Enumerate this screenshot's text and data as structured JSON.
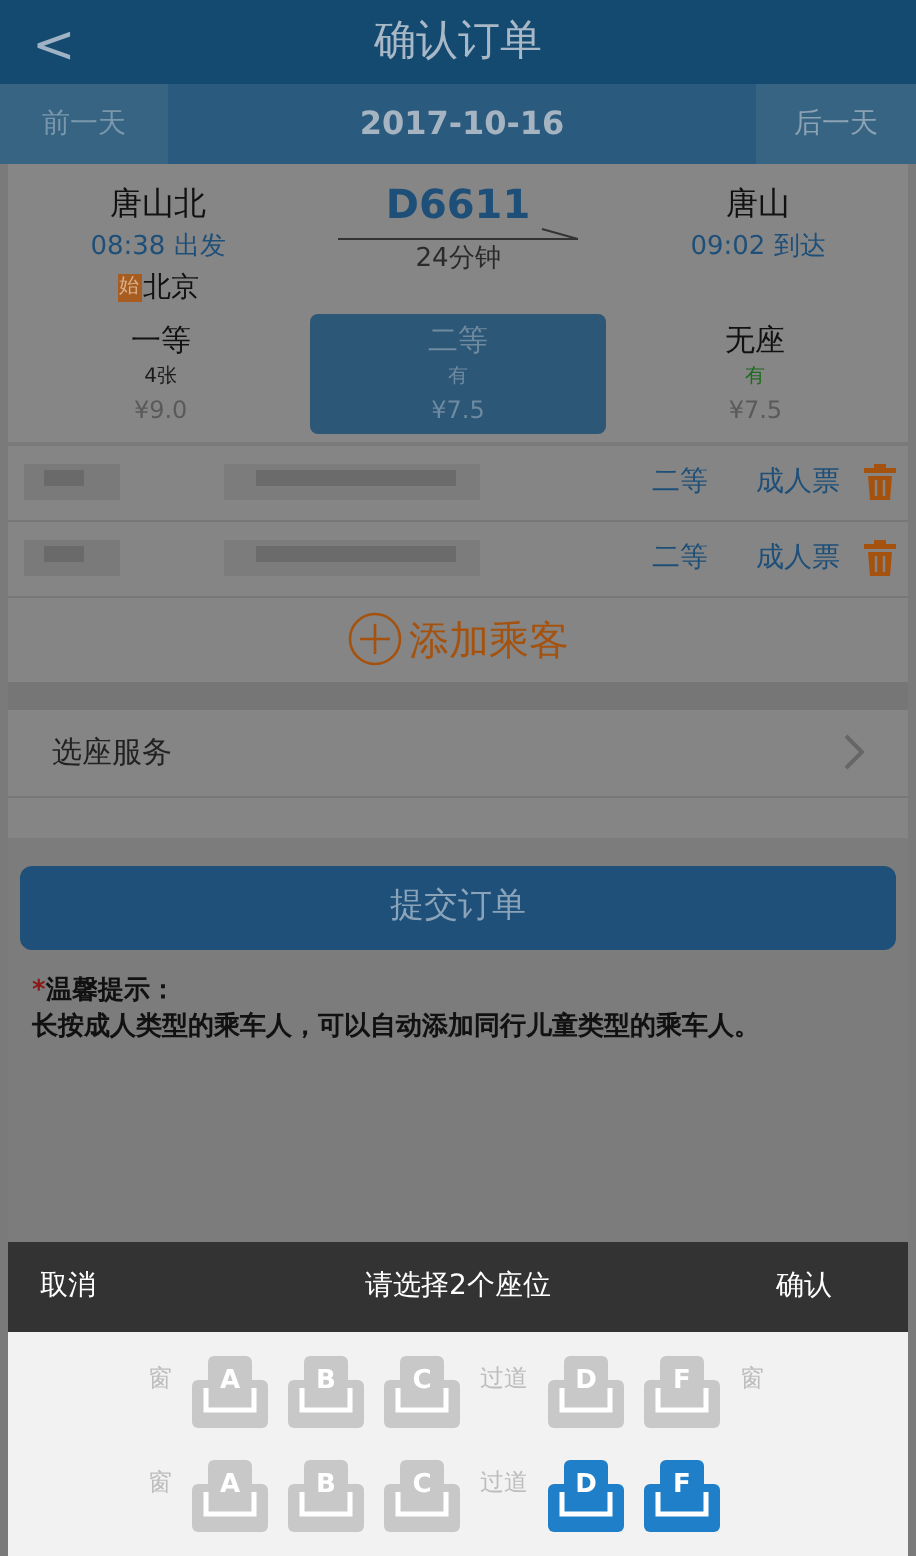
{
  "header": {
    "back": "<",
    "title": "确认订单"
  },
  "date_bar": {
    "prev": "前一天",
    "date": "2017-10-16",
    "next": "后一天"
  },
  "train": {
    "from": {
      "station": "唐山北",
      "time": "08:38 出发",
      "origin_badge": "始",
      "origin": "北京"
    },
    "number": "D6611",
    "duration": "24分钟",
    "to": {
      "station": "唐山",
      "time": "09:02 到达"
    }
  },
  "seat_classes": [
    {
      "name": "一等",
      "availability": "4张",
      "price": "¥9.0",
      "selected": false,
      "color": "#1a1a1a"
    },
    {
      "name": "二等",
      "availability": "有",
      "price": "¥7.5",
      "selected": true,
      "color": "#6e8aa0"
    },
    {
      "name": "无座",
      "availability": "有",
      "price": "¥7.5",
      "selected": false,
      "color": "#1f6b1f"
    }
  ],
  "passengers": [
    {
      "seat_class": "二等",
      "ticket_type": "成人票"
    },
    {
      "seat_class": "二等",
      "ticket_type": "成人票"
    }
  ],
  "add_passenger": "添加乘客",
  "seat_service": "选座服务",
  "submit": "提交订单",
  "tips": {
    "mark": "*",
    "title": "温馨提示：",
    "text": "长按成人类型的乘车人，可以自动添加同行儿童类型的乘车人。"
  },
  "seat_picker": {
    "cancel": "取消",
    "title": "请选择2个座位",
    "confirm": "确认",
    "rows": [
      {
        "items": [
          {
            "kind": "label",
            "text": "窗"
          },
          {
            "kind": "seat",
            "text": "A",
            "selected": false
          },
          {
            "kind": "seat",
            "text": "B",
            "selected": false
          },
          {
            "kind": "seat",
            "text": "C",
            "selected": false
          },
          {
            "kind": "label",
            "text": "过道"
          },
          {
            "kind": "seat",
            "text": "D",
            "selected": false
          },
          {
            "kind": "seat",
            "text": "F",
            "selected": false
          },
          {
            "kind": "label",
            "text": "窗"
          }
        ]
      },
      {
        "items": [
          {
            "kind": "label",
            "text": "窗"
          },
          {
            "kind": "seat",
            "text": "A",
            "selected": false
          },
          {
            "kind": "seat",
            "text": "B",
            "selected": false
          },
          {
            "kind": "seat",
            "text": "C",
            "selected": false
          },
          {
            "kind": "label",
            "text": "过道"
          },
          {
            "kind": "seat",
            "text": "D",
            "selected": true
          },
          {
            "kind": "seat",
            "text": "F",
            "selected": true
          }
        ]
      }
    ]
  }
}
